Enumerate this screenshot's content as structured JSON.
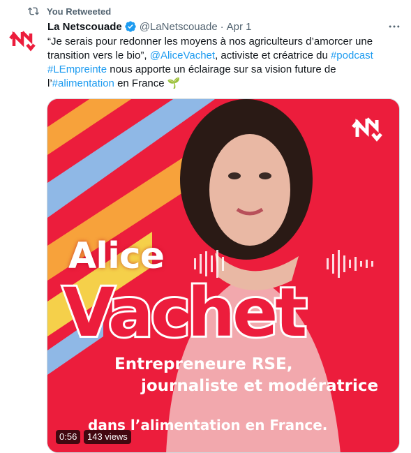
{
  "retweet": {
    "label": "You Retweeted",
    "icon": "retweet-icon"
  },
  "tweet": {
    "author_name": "La Netscouade",
    "verified": true,
    "handle": "@LaNetscouade",
    "separator": "·",
    "date": "Apr 1",
    "more_icon": "more-dots-icon",
    "text": {
      "p1": "“Je serais pour redonner les moyens à nos agriculteurs d’amorcer une transition vers le bio”, ",
      "mention": "@AliceVachet",
      "p2": ", activiste et créatrice du ",
      "hashtag1": "#podcast",
      "p3": " ",
      "hashtag2": "#LEmpreinte",
      "p4": " nous apporte un éclairage sur sa vision future de l’",
      "hashtag3": "#alimentation",
      "p5": " en France ",
      "emoji": "🌱"
    }
  },
  "media": {
    "name_first": "Alice",
    "name_last": "Vachet",
    "subtitle_line1": "Entrepreneure RSE,",
    "subtitle_line2": "journaliste et modératrice",
    "subtitle_line3": "dans l’alimentation en France.",
    "duration": "0:56",
    "views": "143 views",
    "colors": {
      "background": "#ec1d3c",
      "stripe_orange": "#f7a23b",
      "stripe_blue": "#8fb8e6",
      "stripe_yellow": "#f5d04a"
    }
  },
  "brand": {
    "accent": "#ec1d3c",
    "link": "#1d9bf0"
  }
}
